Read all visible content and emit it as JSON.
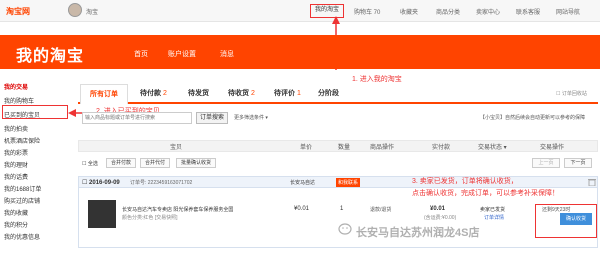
{
  "topbar": {
    "logo": "淘宝网",
    "username": "淘宝",
    "my_taobao": "我的淘宝",
    "nav": [
      "购物车 70",
      "收藏夹",
      "商品分类",
      "卖家中心",
      "联系客服",
      "网站导航"
    ]
  },
  "header": {
    "brand": "我的淘宝",
    "nav": [
      "首页",
      "账户设置",
      "消息"
    ]
  },
  "annotations": {
    "step1": "1. 进入我的淘宝",
    "step2": "2. 进入已买到的宝贝",
    "step3_line1": "3. 卖家已发货，订单将确认收货，",
    "step3_line2": "点击确认收货，完成订单，可以参考补采保障！"
  },
  "sidebar": {
    "section_title": "我的交易",
    "items": [
      "我的购物车",
      "已买到的宝贝",
      "我的拍卖",
      "机票酒店保险",
      "我的彩票",
      "我的理财",
      "我的话费",
      "我的1688订单",
      "购买过的店铺",
      "我的收藏",
      "我的积分",
      "我的优惠信息"
    ]
  },
  "tabs": [
    {
      "label": "所有订单",
      "count": ""
    },
    {
      "label": "待付款",
      "count": "2"
    },
    {
      "label": "待发货",
      "count": ""
    },
    {
      "label": "待收货",
      "count": "2"
    },
    {
      "label": "待评价",
      "count": "1"
    },
    {
      "label": "分阶段",
      "count": ""
    }
  ],
  "tabs_right": "☐ 订单回收站",
  "search": {
    "placeholder": "输入商品标题或订单号进行搜索",
    "button": "订单搜索",
    "more": "更多筛选条件 ▾",
    "notice": "【小宝贝】自然后续会自动更新可以参考的保障"
  },
  "table_header": [
    "宝贝",
    "单价",
    "数量",
    "商品操作",
    "实付款",
    "交易状态 ▾",
    "交易操作"
  ],
  "toolbar": {
    "select_all": "☐ 全选",
    "merge_pay": "合并付款",
    "merge_pay2": "合并代付",
    "batch_confirm": "批量确认收货",
    "prev": "上一页",
    "next": "下一页"
  },
  "order": {
    "date": "☐ 2016-09-09",
    "order_no": "订单号: 2223459163071702",
    "shop": "长安马自达",
    "contact": "和我联系",
    "title_line1": "长安马自达汽车专卖店 阳光保养套车保养服务全国",
    "title_line2": "颜色分类:红色 [交易快照]",
    "price": "¥0.01",
    "qty": "1",
    "action": "退款/退货",
    "paid": "¥0.01",
    "paid_note": "(含运费:¥0.00)",
    "status": "卖家已发货",
    "status_link": "订单详情",
    "remaining": "还剩9天23时",
    "confirm": "确认收货"
  },
  "watermark": "长安马自达苏州润龙4S店"
}
